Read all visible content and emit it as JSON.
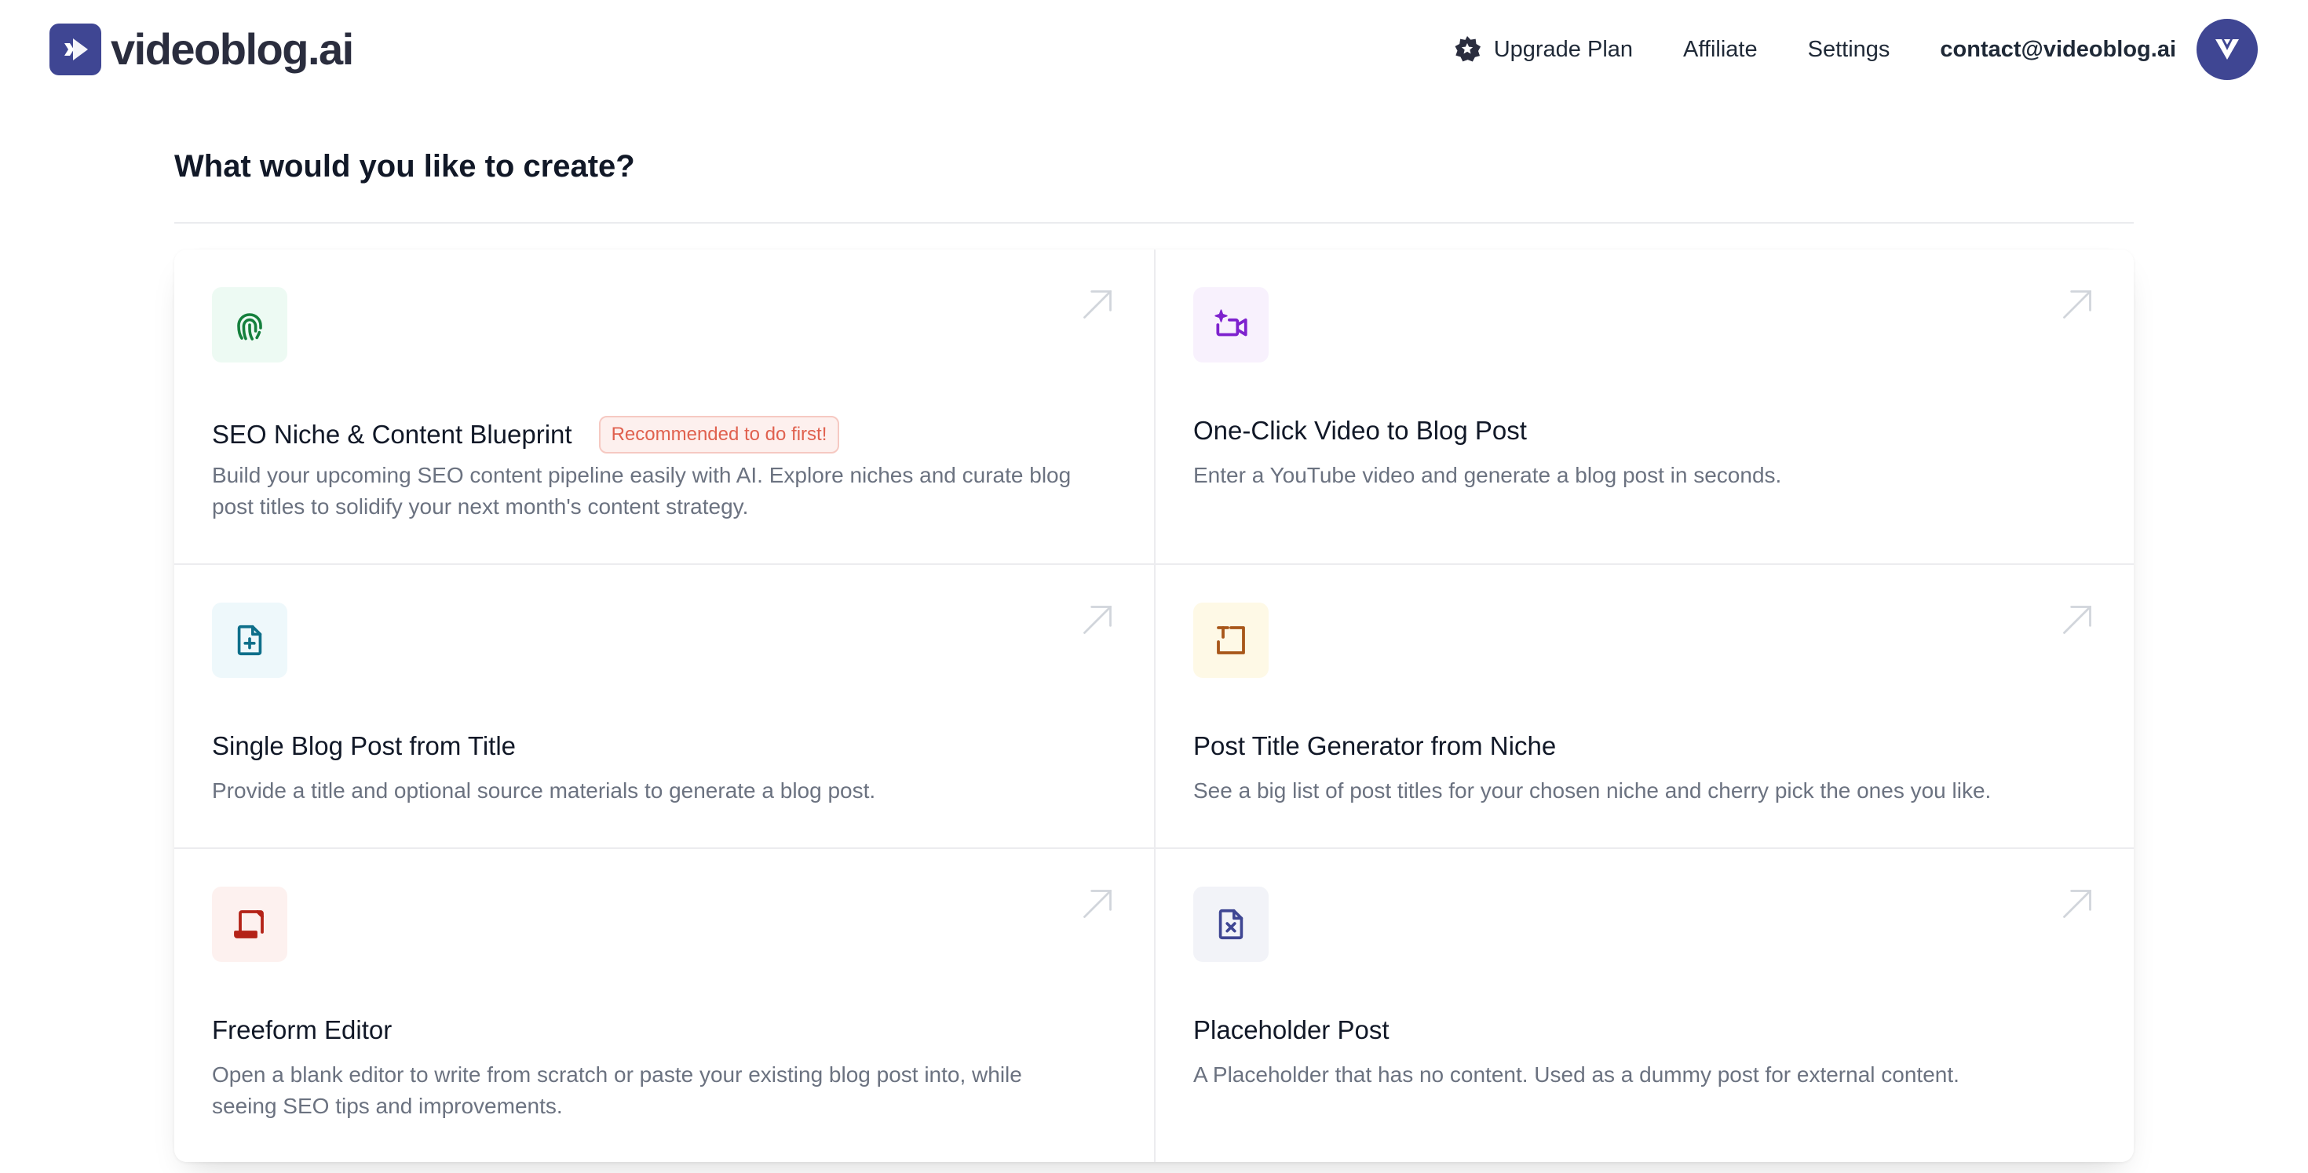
{
  "header": {
    "brand": "videoblog.ai",
    "nav": {
      "upgrade": "Upgrade Plan",
      "affiliate": "Affiliate",
      "settings": "Settings",
      "email": "contact@videoblog.ai"
    }
  },
  "main": {
    "heading": "What would you like to create?",
    "cards": [
      {
        "title": "SEO Niche & Content Blueprint",
        "badge": "Recommended to do first!",
        "desc": "Build your upcoming SEO content pipeline easily with AI. Explore niches and curate blog post titles to solidify your next month's content strategy.",
        "icon": "fingerprint-icon",
        "accent": "#15803d",
        "bg": "#edfaf3"
      },
      {
        "title": "One-Click Video to Blog Post",
        "desc": "Enter a YouTube video and generate a blog post in seconds.",
        "icon": "video-sparkle-icon",
        "accent": "#7e22ce",
        "bg": "#f8f1fd"
      },
      {
        "title": "Single Blog Post from Title",
        "desc": "Provide a title and optional source materials to generate a blog post.",
        "icon": "file-plus-icon",
        "accent": "#0e6f8a",
        "bg": "#eef8fb"
      },
      {
        "title": "Post Title Generator from Niche",
        "desc": "See a big list of post titles for your chosen niche and cherry pick the ones you like.",
        "icon": "text-frame-icon",
        "accent": "#a8571a",
        "bg": "#fef9e6"
      },
      {
        "title": "Freeform Editor",
        "desc": "Open a blank editor to write from scratch or paste your existing blog post into, while seeing SEO tips and improvements.",
        "icon": "scroll-icon",
        "accent": "#b42318",
        "bg": "#fdf1ef"
      },
      {
        "title": "Placeholder Post",
        "desc": "A Placeholder that has no content. Used as a dummy post for external content.",
        "icon": "file-x-icon",
        "accent": "#3f4693",
        "bg": "#f2f3f8"
      }
    ]
  },
  "colors": {
    "brand": "#3f4693",
    "badge_text": "#e0614f",
    "badge_bg": "#fdf0ee",
    "description": "#6b7280",
    "arrow": "#d1d5db"
  }
}
